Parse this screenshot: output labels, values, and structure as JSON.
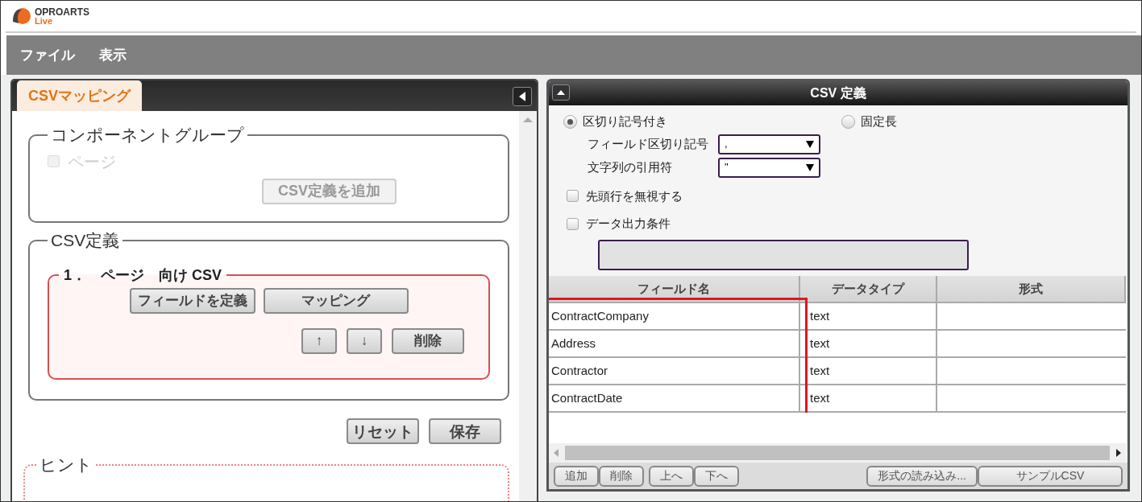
{
  "logo": {
    "brand": "OPROARTS",
    "sub": "Live"
  },
  "menu": [
    "ファイル",
    "表示"
  ],
  "left_panel": {
    "tabs": [
      {
        "label": "CSVマッピング",
        "selected": true
      }
    ],
    "component_group": {
      "legend": "コンポーネントグループ",
      "items": [
        {
          "label": "ページ",
          "checked": false,
          "disabled": true
        }
      ],
      "add_button": {
        "label": "CSV定義を追加",
        "disabled": true
      }
    },
    "csv_definition": {
      "legend": "CSV定義",
      "entries": [
        {
          "title": "1．　ページ　向け CSV",
          "buttons": [
            "フィールドを定義",
            "マッピング"
          ],
          "actions": [
            "↑",
            "↓",
            "削除"
          ]
        }
      ]
    },
    "buttons": [
      "リセット",
      "保存"
    ],
    "hint": {
      "legend": "ヒント"
    }
  },
  "right_panel": {
    "title": "CSV 定義",
    "format_options": [
      {
        "label": "区切り記号付き",
        "selected": true
      },
      {
        "label": "固定長",
        "selected": false
      }
    ],
    "selects": [
      {
        "label": "フィールド区切り記号",
        "value": ","
      },
      {
        "label": "文字列の引用符",
        "value": "\""
      }
    ],
    "checkboxes": [
      {
        "label": "先頭行を無視する",
        "checked": false
      },
      {
        "label": "データ出力条件",
        "checked": false
      }
    ],
    "table": {
      "columns": [
        "フィールド名",
        "データタイプ",
        "形式"
      ],
      "rows": [
        {
          "field_name": "ContractCompany",
          "data_type": "text"
        },
        {
          "field_name": "Address",
          "data_type": "text"
        },
        {
          "field_name": "Contractor",
          "data_type": "text"
        },
        {
          "field_name": "ContractDate",
          "data_type": "text"
        }
      ]
    },
    "toolbar_groups": [
      [
        "追加",
        "削除"
      ],
      [
        "上へ",
        "下へ"
      ],
      [
        "形式の読み込み...",
        "サンプルCSV"
      ]
    ]
  }
}
